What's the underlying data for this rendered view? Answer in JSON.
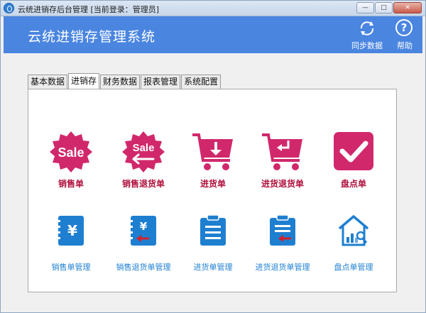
{
  "window": {
    "title": "云统进销存后台管理 [当前登录：管理员]",
    "controls": [
      "minimize",
      "maximize",
      "close"
    ]
  },
  "header": {
    "title": "云统进销存管理系统",
    "sync_label": "同步数据",
    "help_label": "帮助",
    "background_color": "#4a85e0"
  },
  "tabs": [
    {
      "label": "基本数据",
      "active": false
    },
    {
      "label": "进销存",
      "active": true
    },
    {
      "label": "财务数据",
      "active": false
    },
    {
      "label": "报表管理",
      "active": false
    },
    {
      "label": "系统配置",
      "active": false
    }
  ],
  "modules_row1": [
    {
      "label": "销售单",
      "icon": "sale-badge-icon",
      "icon_text": "Sale"
    },
    {
      "label": "销售退货单",
      "icon": "sale-return-badge-icon",
      "icon_text": "Sale"
    },
    {
      "label": "进货单",
      "icon": "cart-down-arrow-icon"
    },
    {
      "label": "进货退货单",
      "icon": "cart-return-icon"
    },
    {
      "label": "盘点单",
      "icon": "checkmark-box-icon"
    }
  ],
  "modules_row2": [
    {
      "label": "销售单管理",
      "icon": "yen-notebook-icon"
    },
    {
      "label": "销售退货单管理",
      "icon": "yen-notebook-return-icon"
    },
    {
      "label": "进货单管理",
      "icon": "clipboard-list-icon"
    },
    {
      "label": "进货退货单管理",
      "icon": "clipboard-return-icon"
    },
    {
      "label": "盘点单管理",
      "icon": "house-chart-icon"
    }
  ],
  "colors": {
    "row1_accent": "#d1286c",
    "row1_label": "#b0103c",
    "row2_accent": "#1e7fd0",
    "return_arrow": "#d3202c"
  }
}
